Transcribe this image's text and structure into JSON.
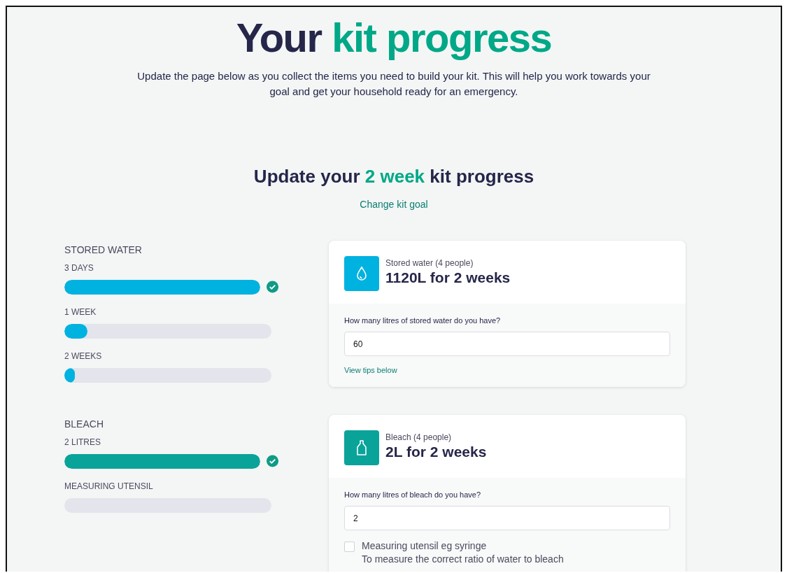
{
  "title": {
    "parts": [
      {
        "text": "Your",
        "highlight": false
      },
      {
        "text": "kit progress",
        "highlight": true
      }
    ]
  },
  "intro": "Update the page below as you collect the items you need to build your kit. This will help you work towards your goal and get your household ready for an emergency.",
  "section_heading": {
    "parts": [
      {
        "text": "Update your",
        "highlight": false
      },
      {
        "text": "2 week",
        "highlight": true
      },
      {
        "text": "kit progress",
        "highlight": false
      }
    ]
  },
  "change_goal_link": "Change kit goal",
  "groups": [
    {
      "name": "STORED WATER",
      "color": "#00b2e0",
      "kind": "water",
      "bars": [
        {
          "label": "3 DAYS",
          "level": 1,
          "complete": true
        },
        {
          "label": "1 WEEK",
          "level": 0.11,
          "complete": false
        },
        {
          "label": "2 WEEKS",
          "level": 0.05,
          "complete": false
        }
      ],
      "card": {
        "subtitle": "Stored water (4 people)",
        "heading": "1120L for 2 weeks",
        "field_label": "How many litres of stored water do you have?",
        "value": "60",
        "extras": [
          {
            "kind": "link",
            "text": "View tips below"
          }
        ]
      }
    },
    {
      "name": "BLEACH",
      "color": "#0aa39a",
      "kind": "bleach",
      "bars": [
        {
          "label": "2 LITRES",
          "level": 1,
          "complete": true
        },
        {
          "label": "MEASURING UTENSIL",
          "level": 0,
          "complete": false
        }
      ],
      "card": {
        "subtitle": "Bleach (4 people)",
        "heading": "2L for 2 weeks",
        "field_label": "How many litres of bleach do you have?",
        "value": "2",
        "extras": [
          {
            "kind": "checkbox",
            "text": "Measuring utensil eg syringe",
            "note": "To measure the correct ratio of water to bleach",
            "checked": false
          }
        ]
      }
    }
  ]
}
